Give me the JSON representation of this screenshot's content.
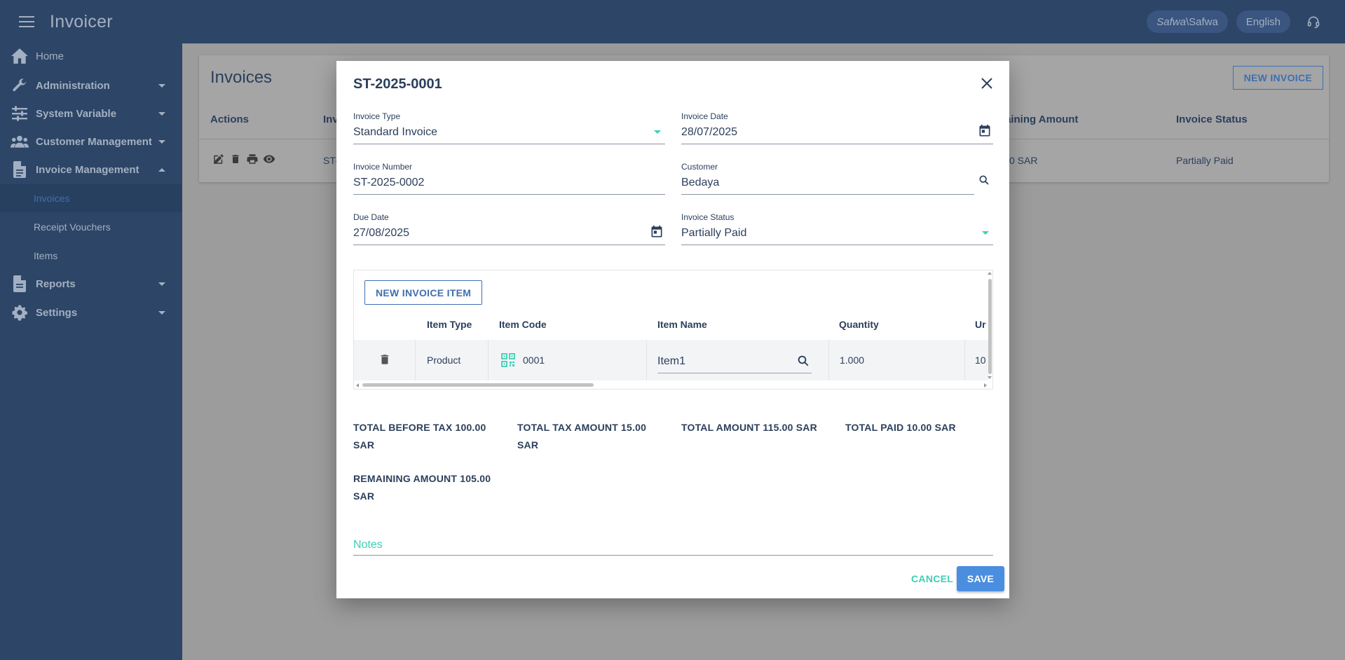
{
  "app": {
    "title": "Invoicer",
    "user_chip_italic": "Safwa",
    "user_chip_rest": "\\Safwa",
    "language": "English"
  },
  "sidebar": {
    "items": [
      {
        "label": "Home",
        "icon": "home-icon"
      },
      {
        "label": "Administration",
        "icon": "wrench-icon"
      },
      {
        "label": "System Variable",
        "icon": "sliders-icon"
      },
      {
        "label": "Customer Management",
        "icon": "users-icon"
      },
      {
        "label": "Invoice Management",
        "icon": "document-icon"
      },
      {
        "label": "Reports",
        "icon": "document-icon"
      },
      {
        "label": "Settings",
        "icon": "gear-icon"
      }
    ],
    "subitems": [
      {
        "label": "Invoices",
        "active": true
      },
      {
        "label": "Receipt Vouchers"
      },
      {
        "label": "Items"
      }
    ]
  },
  "page": {
    "title": "Invoices",
    "new_invoice_label": "NEW INVOICE",
    "columns": {
      "actions": "Actions",
      "invoice_partial": "Inv",
      "remaining_partial": "aining Amount",
      "status": "Invoice Status"
    },
    "row": {
      "invoice_partial": "ST-",
      "remaining_partial": "0 SAR",
      "status": "Partially Paid"
    }
  },
  "modal": {
    "title": "ST-2025-0001",
    "fields": {
      "invoice_type": {
        "label": "Invoice Type",
        "value": "Standard Invoice"
      },
      "invoice_date": {
        "label": "Invoice Date",
        "value": "28/07/2025"
      },
      "invoice_number": {
        "label": "Invoice Number",
        "value": "ST-2025-0002"
      },
      "customer": {
        "label": "Customer",
        "value": "Bedaya"
      },
      "due_date": {
        "label": "Due Date",
        "value": "27/08/2025"
      },
      "invoice_status": {
        "label": "Invoice Status",
        "value": "Partially Paid"
      }
    },
    "items": {
      "new_item_label": "NEW INVOICE ITEM",
      "columns": {
        "type": "Item Type",
        "code": "Item Code",
        "name": "Item Name",
        "quantity": "Quantity",
        "unit_partial": "Ur"
      },
      "rows": [
        {
          "type": "Product",
          "code": "0001",
          "name": "Item1",
          "quantity": "1.000",
          "unit_partial": "10"
        }
      ]
    },
    "totals": {
      "before_tax_line1": "TOTAL BEFORE TAX 100.00",
      "before_tax_line2": "SAR",
      "tax_line1": "TOTAL TAX AMOUNT 15.00",
      "tax_line2": "SAR",
      "amount": "TOTAL AMOUNT 115.00 SAR",
      "paid": "TOTAL PAID 10.00 SAR",
      "remaining_line1": "REMAINING AMOUNT 105.00",
      "remaining_line2": "SAR"
    },
    "notes_placeholder": "Notes",
    "cancel_label": "CANCEL",
    "save_label": "SAVE"
  },
  "colors": {
    "navy": "#2d4566",
    "accent_teal": "#3fcfb5",
    "primary_blue": "#4a8ee0",
    "link_blue": "#3f6fae"
  }
}
